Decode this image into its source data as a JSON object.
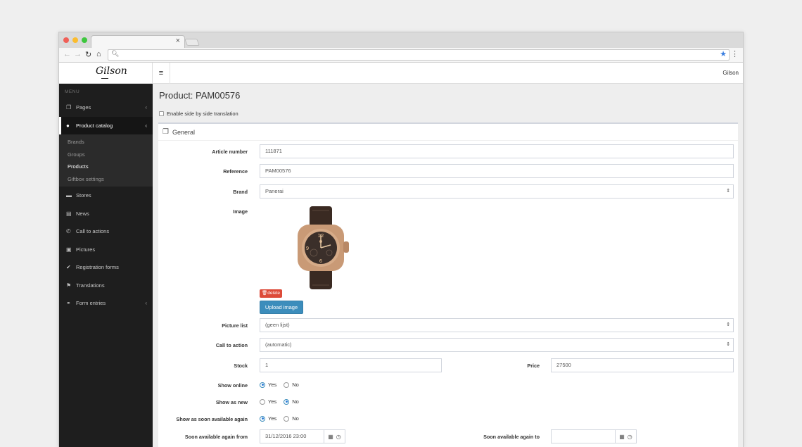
{
  "browser": {
    "tab_close": "×",
    "colors": {
      "red": "#f05f57",
      "yellow": "#fbbc2e",
      "green": "#3ec73e"
    }
  },
  "app": {
    "logo_text": "Gilson",
    "user_name": "Gilson"
  },
  "sidebar": {
    "menu_label": "MENU",
    "items": [
      {
        "label": "Pages",
        "icon": "copy-icon",
        "arrow": true
      },
      {
        "label": "Product catalog",
        "icon": "product-icon",
        "arrow": true,
        "active": true
      },
      {
        "label": "Stores",
        "icon": "car-icon"
      },
      {
        "label": "News",
        "icon": "newspaper-icon"
      },
      {
        "label": "Call to actions",
        "icon": "phone-icon"
      },
      {
        "label": "Pictures",
        "icon": "picture-icon"
      },
      {
        "label": "Registration forms",
        "icon": "check-icon"
      },
      {
        "label": "Translations",
        "icon": "flag-icon"
      },
      {
        "label": "Form entries",
        "icon": "link-icon",
        "arrow": true
      }
    ],
    "submenu": [
      "Brands",
      "Groups",
      "Products",
      "Giftbox settings"
    ]
  },
  "page": {
    "title": "Product: PAM00576",
    "translation_label": "Enable side by side translation",
    "panel_title": "General"
  },
  "form": {
    "article_number_label": "Article number",
    "article_number": "111871",
    "reference_label": "Reference",
    "reference": "PAM00576",
    "brand_label": "Brand",
    "brand": "Panerai",
    "image_label": "Image",
    "delete_label": "delete",
    "upload_label": "Upload image",
    "picture_list_label": "Picture list",
    "picture_list": "(geen lijst)",
    "call_to_action_label": "Call to action",
    "call_to_action": "(automatic)",
    "stock_label": "Stock",
    "stock": "1",
    "price_label": "Price",
    "price": "27500",
    "show_online_label": "Show online",
    "show_online": "Yes",
    "show_as_new_label": "Show as new",
    "show_as_new": "No",
    "show_soon_label": "Show as soon available again",
    "show_soon": "Yes",
    "yes": "Yes",
    "no": "No",
    "soon_from_label": "Soon available again from",
    "soon_from": "31/12/2016 23:00",
    "soon_to_label": "Soon available again to",
    "soon_to": ""
  }
}
